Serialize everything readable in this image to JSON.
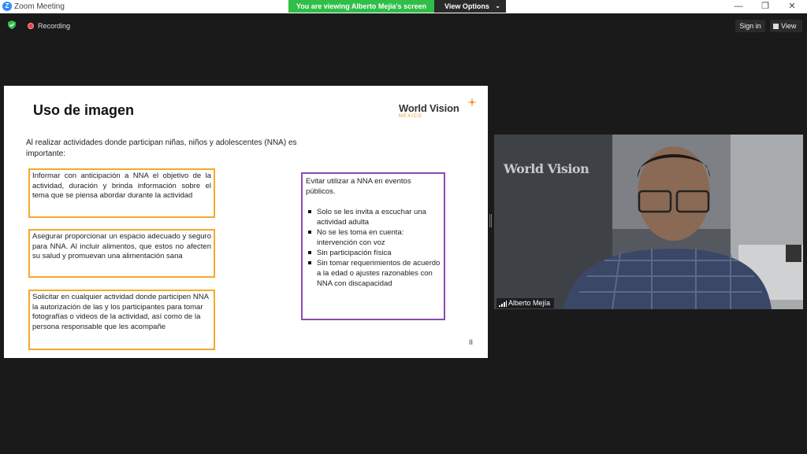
{
  "window": {
    "title": "Zoom Meeting",
    "icon": "zoom-logo-icon",
    "controls": {
      "minimize": "—",
      "restore": "❐",
      "close": "✕"
    }
  },
  "share_banner": {
    "text": "You are viewing Alberto Mejía's screen",
    "color": "#2fbf48",
    "view_options_label": "View Options",
    "chevron": "⌄"
  },
  "toolbar": {
    "security_icon": "shield-check-icon",
    "recording_label": "Recording",
    "sign_in_label": "Sign in",
    "view_label": "View"
  },
  "slide": {
    "title": "Uso de imagen",
    "logo": {
      "name": "World Vision",
      "sub": "MÉXICO",
      "accent": "#f7941d"
    },
    "intro": "Al realizar actividades donde participan niñas, niños y adolescentes (NNA) es importante:",
    "orange_boxes": [
      "Informar con anticipación a NNA el objetivo de la actividad, duración y brinda información sobre el tema que se piensa abordar durante la actividad",
      "Asegurar proporcionar un espacio adecuado y seguro para NNA. Al incluir alimentos, que estos no afecten su salud y promuevan una alimentación sana",
      "Solicitar en cualquier actividad donde participen NNA la autorización de las y los participantes para tomar fotografías o videos de la actividad, así como de la persona responsable que les acompañe"
    ],
    "purple_box": {
      "heading": "Evitar utilizar a NNA en eventos públicos.",
      "bullets": [
        "Solo se les invita a escuchar una actividad adulta",
        "No se les toma en cuenta: intervención con voz",
        "Sin participación física",
        "Sin tomar requerimientos de acuerdo a la edad o ajustes razonables con NNA con discapacidad"
      ]
    },
    "pager": "II",
    "colors": {
      "orange": "#f7a829",
      "purple": "#8a4bb3"
    }
  },
  "video": {
    "participant_name": "Alberto Mejía",
    "background_logo": "World Vision"
  }
}
